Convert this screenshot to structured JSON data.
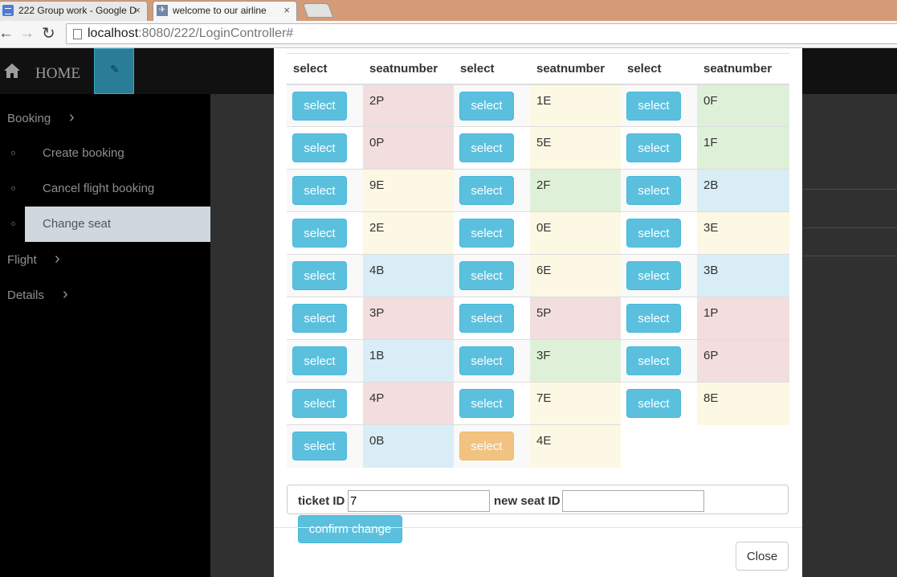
{
  "browser": {
    "tabs": [
      {
        "title": "222 Group work - Google D",
        "close": "×"
      },
      {
        "title": "welcome to our airline",
        "close": "×"
      }
    ],
    "nav": {
      "back": "←",
      "forward": "→",
      "reload": "↻"
    },
    "url_host": "localhost",
    "url_rest": ":8080/222/LoginController#"
  },
  "topnav": {
    "home_label": "HOME",
    "edit_icon": "✎"
  },
  "sidebar": {
    "booking": "Booking",
    "sub_items": [
      "Create booking",
      "Cancel flight booking",
      "Change seat"
    ],
    "flight": "Flight",
    "details": "Details",
    "chevron": "›"
  },
  "seat_table": {
    "headers": [
      "select",
      "seatnumber",
      "select",
      "seatnumber",
      "select",
      "seatnumber"
    ],
    "button_label": "select",
    "rows": [
      [
        {
          "seat": "2P",
          "color": "danger"
        },
        {
          "seat": "1E",
          "color": "warning"
        },
        {
          "seat": "0F",
          "color": "success"
        }
      ],
      [
        {
          "seat": "0P",
          "color": "danger"
        },
        {
          "seat": "5E",
          "color": "warning"
        },
        {
          "seat": "1F",
          "color": "success"
        }
      ],
      [
        {
          "seat": "9E",
          "color": "warning"
        },
        {
          "seat": "2F",
          "color": "success"
        },
        {
          "seat": "2B",
          "color": "info"
        }
      ],
      [
        {
          "seat": "2E",
          "color": "warning"
        },
        {
          "seat": "0E",
          "color": "warning"
        },
        {
          "seat": "3E",
          "color": "warning"
        }
      ],
      [
        {
          "seat": "4B",
          "color": "info"
        },
        {
          "seat": "6E",
          "color": "warning"
        },
        {
          "seat": "3B",
          "color": "info"
        }
      ],
      [
        {
          "seat": "3P",
          "color": "danger"
        },
        {
          "seat": "5P",
          "color": "danger"
        },
        {
          "seat": "1P",
          "color": "danger"
        }
      ],
      [
        {
          "seat": "1B",
          "color": "info"
        },
        {
          "seat": "3F",
          "color": "success"
        },
        {
          "seat": "6P",
          "color": "danger"
        }
      ],
      [
        {
          "seat": "4P",
          "color": "danger"
        },
        {
          "seat": "7E",
          "color": "warning"
        },
        {
          "seat": "8E",
          "color": "warning"
        }
      ],
      [
        {
          "seat": "0B",
          "color": "info"
        },
        {
          "seat": "4E",
          "color": "warning",
          "button": "warning"
        }
      ]
    ]
  },
  "change_form": {
    "ticket_label": "ticket ID",
    "ticket_value": "7",
    "seat_label": "new seat ID",
    "seat_value": "",
    "confirm_label": "confirm change"
  },
  "modal": {
    "close_label": "Close"
  },
  "colors": {
    "info_button": "#5bc0de",
    "warning_button": "#f0ad4e",
    "danger_cell": "#f2dede",
    "warning_cell": "#fcf8e3",
    "success_cell": "#dff0d8",
    "info_cell": "#d9edf7"
  }
}
